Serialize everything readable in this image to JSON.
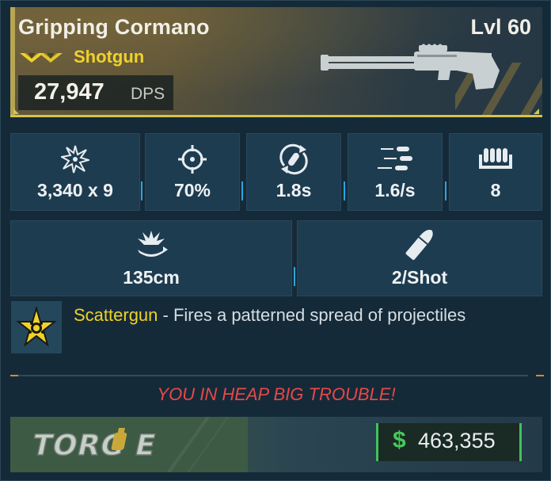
{
  "item": {
    "name": "Gripping Cormano",
    "level": "Lvl 60",
    "type": "Shotgun",
    "dps_value": "27,947",
    "dps_unit": "DPS"
  },
  "stats_row1": [
    {
      "icon": "damage-burst-icon",
      "value": "3,340 x 9"
    },
    {
      "icon": "crosshair-icon",
      "value": "70%"
    },
    {
      "icon": "reload-icon",
      "value": "1.8s"
    },
    {
      "icon": "fire-rate-icon",
      "value": "1.6/s"
    },
    {
      "icon": "magazine-icon",
      "value": "8"
    }
  ],
  "stats_row2": [
    {
      "icon": "splash-radius-icon",
      "value": "135cm"
    },
    {
      "icon": "ammo-cost-icon",
      "value": "2/Shot"
    }
  ],
  "perk": {
    "icon": "star-badge-icon",
    "name": "Scattergun",
    "dash": " - ",
    "description": "Fires a patterned spread of projectiles"
  },
  "flavor_text": "YOU IN HEAP BIG TROUBLE!",
  "manufacturer": {
    "logo_text": "TORGUE"
  },
  "price": {
    "symbol": "$",
    "value": "463,355"
  },
  "colors": {
    "rarity": "#efd22a",
    "accent_line": "#d6c34a",
    "flavor": "#e8484a",
    "price_accent": "#41c25f",
    "tile_bg": "#1e3c50",
    "tile_tick": "#2fa4dc"
  }
}
